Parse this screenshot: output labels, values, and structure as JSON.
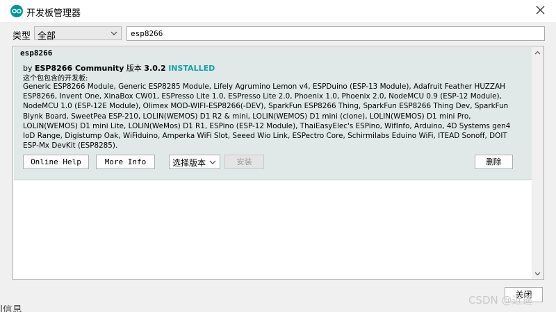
{
  "window": {
    "title": "开发板管理器",
    "icons": {
      "app": "arduino-icon",
      "close": "close-icon"
    }
  },
  "filter": {
    "type_label": "类型",
    "type_value": "全部",
    "search_value": "esp8266"
  },
  "entry": {
    "name": "esp8266",
    "by_prefix": "by",
    "author": "ESP8266 Community",
    "version_label": "版本",
    "version": "3.0.2",
    "status": "INSTALLED",
    "boards_label": "这个包包含的开发板:",
    "boards": "Generic ESP8266 Module, Generic ESP8285 Module, Lifely Agrumino Lemon v4, ESPDuino (ESP-13 Module), Adafruit Feather HUZZAH ESP8266, Invent One, XinaBox CW01, ESPresso Lite 1.0, ESPresso Lite 2.0, Phoenix 1.0, Phoenix 2.0, NodeMCU 0.9 (ESP-12 Module), NodeMCU 1.0 (ESP-12E Module), Olimex MOD-WIFI-ESP8266(-DEV), SparkFun ESP8266 Thing, SparkFun ESP8266 Thing Dev, SparkFun Blynk Board, SweetPea ESP-210, LOLIN(WEMOS) D1 R2 & mini, LOLIN(WEMOS) D1 mini (clone), LOLIN(WEMOS) D1 mini Pro, LOLIN(WEMOS) D1 mini Lite, LOLIN(WeMos) D1 R1, ESPino (ESP-12 Module), ThaiEasyElec's ESPino, WifInfo, Arduino, 4D Systems gen4 IoD Range, Digistump Oak, WiFiduino, Amperka WiFi Slot, Seeed Wio Link, ESPectro Core, Schirmilabs Eduino WiFi, ITEAD Sonoff, DOIT ESP-Mx DevKit (ESP8285).",
    "buttons": {
      "online_help": "Online Help",
      "more_info": "More Info",
      "select_version": "选择版本",
      "install": "安装",
      "remove": "删除"
    }
  },
  "footer": {
    "close": "关闭",
    "watermark": "CSDN @近遥",
    "behind_text": "l信息"
  }
}
